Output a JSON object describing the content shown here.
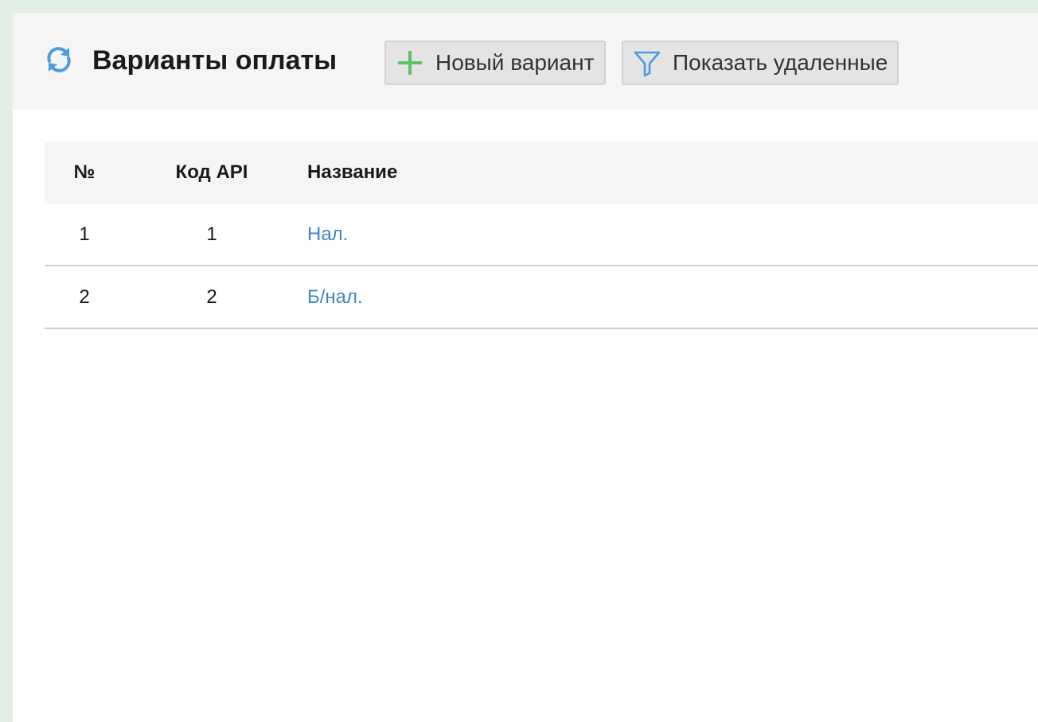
{
  "header": {
    "title": "Варианты оплаты",
    "refresh_icon": "refresh-icon",
    "new_button_label": "Новый вариант",
    "new_button_icon": "plus-icon",
    "show_deleted_label": "Показать удаленные",
    "show_deleted_icon": "filter-icon"
  },
  "colors": {
    "accent_blue": "#4a9be0",
    "plus_green": "#5cc36b",
    "link_blue": "#3d87c8",
    "outer_background": "#e2efe6"
  },
  "table": {
    "columns": [
      "№",
      "Код API",
      "Название"
    ],
    "rows": [
      {
        "num": "1",
        "api_code": "1",
        "name": "Нал."
      },
      {
        "num": "2",
        "api_code": "2",
        "name": "Б/нал."
      }
    ]
  }
}
